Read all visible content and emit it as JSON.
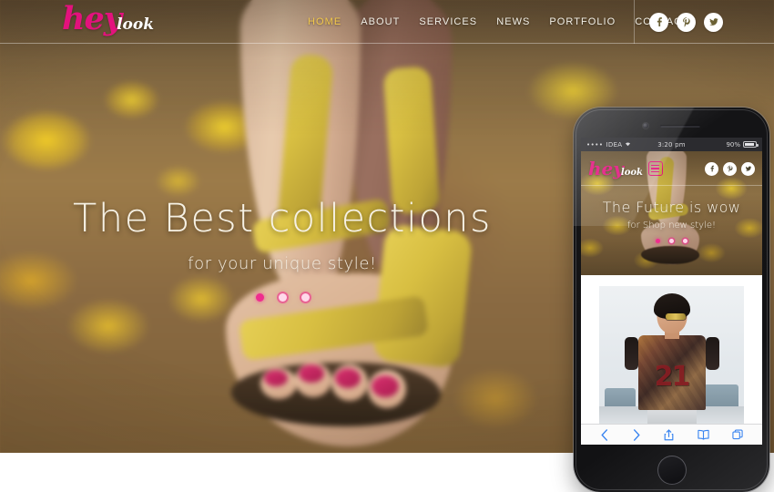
{
  "site": {
    "logo": {
      "primary": "hey",
      "secondary": "look"
    },
    "nav": [
      {
        "label": "HOME",
        "active": true
      },
      {
        "label": "ABOUT",
        "active": false
      },
      {
        "label": "SERVICES",
        "active": false
      },
      {
        "label": "NEWS",
        "active": false
      },
      {
        "label": "PORTFOLIO",
        "active": false
      },
      {
        "label": "CONTACTS",
        "active": false
      }
    ],
    "socials": [
      {
        "name": "facebook",
        "glyph": "f"
      },
      {
        "name": "pinterest",
        "glyph": "P"
      },
      {
        "name": "twitter",
        "glyph": "t"
      }
    ],
    "hero": {
      "title": "The Best collections",
      "subtitle": "for your unique style!",
      "slides": 3,
      "active_slide": 1
    }
  },
  "phone": {
    "status_bar": {
      "signal": "••••",
      "carrier": "IDEA",
      "wifi": "wifi-icon",
      "time": "3:20 pm",
      "battery_percent": "90%"
    },
    "site": {
      "logo": {
        "primary": "hey",
        "secondary": "look"
      },
      "menu_icon": "hamburger-menu-icon",
      "socials": [
        {
          "name": "facebook",
          "glyph": "f"
        },
        {
          "name": "pinterest",
          "glyph": "P"
        },
        {
          "name": "twitter",
          "glyph": "t"
        }
      ],
      "hero": {
        "title": "The Future is wow",
        "subtitle": "for Shop new style!",
        "slides": 3,
        "active_slide": 1
      },
      "content": {
        "shirt_number": "21"
      }
    },
    "toolbar": [
      {
        "name": "back",
        "icon": "chevron-left-icon"
      },
      {
        "name": "forward",
        "icon": "chevron-right-icon"
      },
      {
        "name": "share",
        "icon": "share-icon"
      },
      {
        "name": "bookmarks",
        "icon": "book-icon"
      },
      {
        "name": "tabs",
        "icon": "tabs-icon"
      }
    ]
  },
  "colors": {
    "brand_pink": "#e3127d",
    "accent_gold": "#f2c84b",
    "dot_active": "#ef2d8e",
    "toolbar_blue": "#3a85f0"
  }
}
